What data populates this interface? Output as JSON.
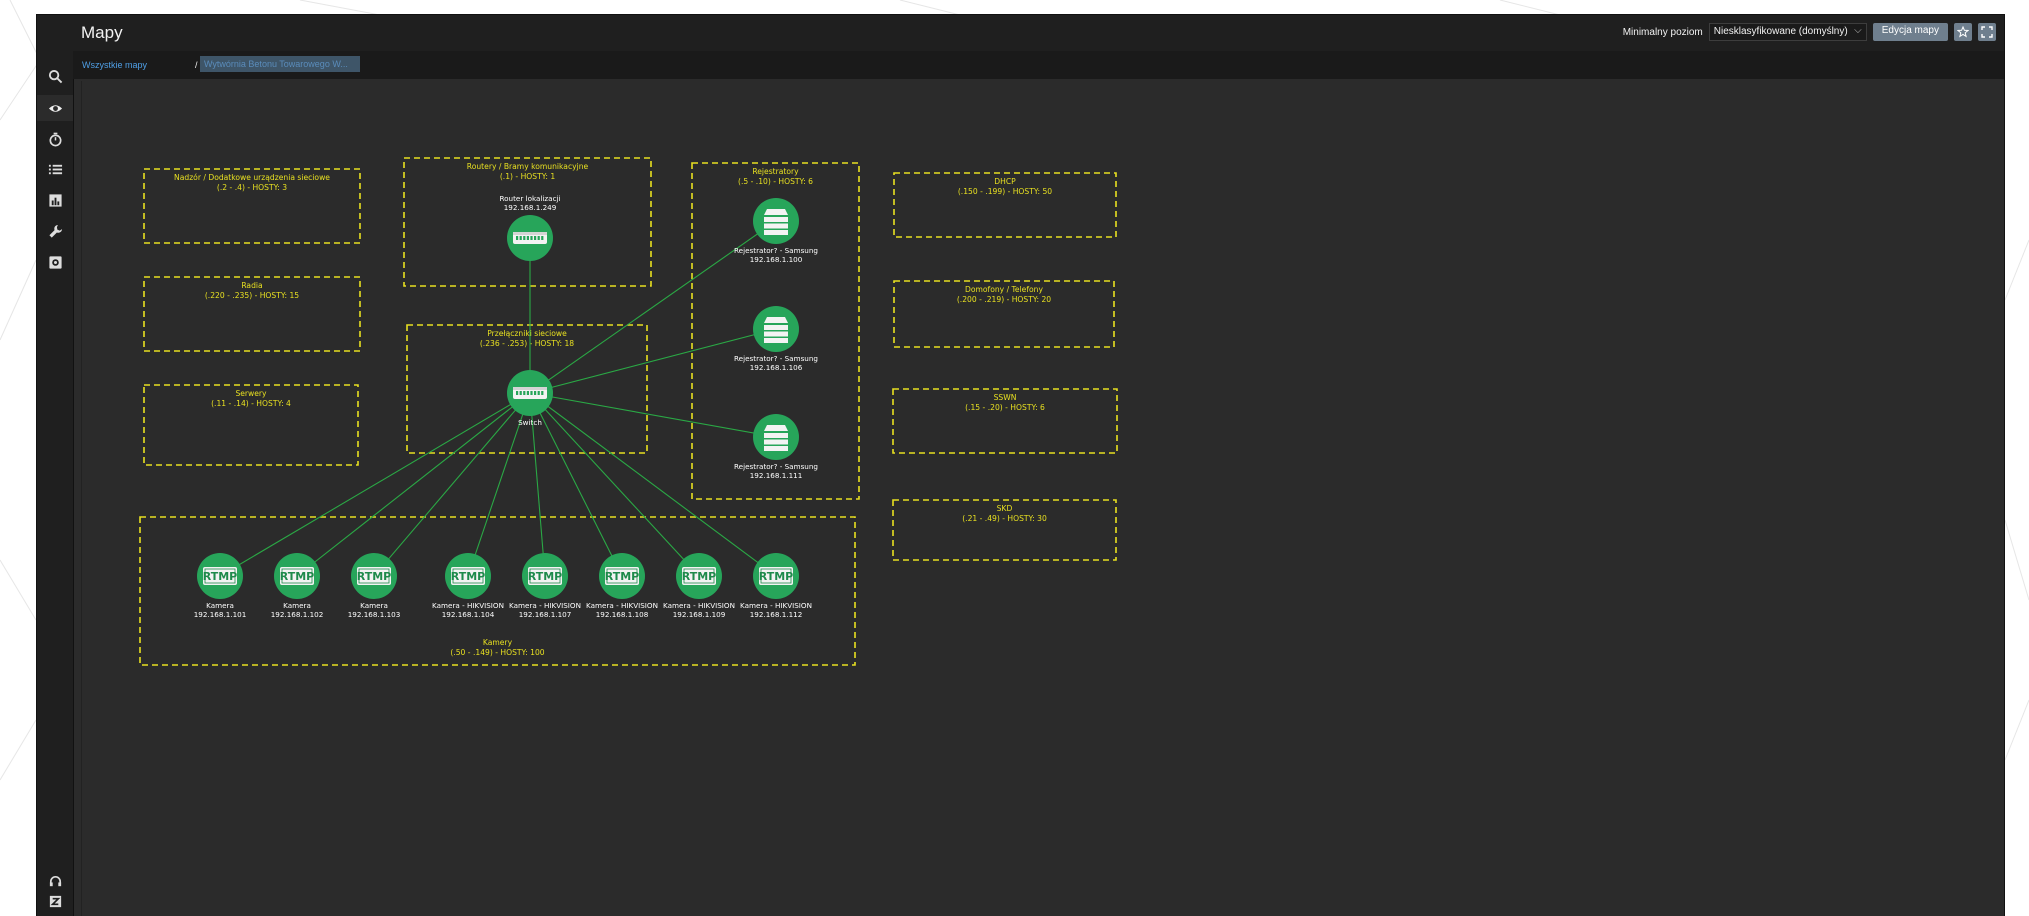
{
  "header": {
    "title": "Mapy",
    "min_level_label": "Minimalny poziom",
    "min_level_value": "Niesklasyfikowane (domyślny)",
    "edit_button": "Edycja mapy"
  },
  "breadcrumbs": [
    "Wszystkie mapy",
    "Wytwórnia Betonu Towarowego W..."
  ],
  "sidebar": {
    "top_icons": [
      "search-icon",
      "eye-icon",
      "stopwatch-icon",
      "list-icon",
      "chart-icon",
      "wrench-icon",
      "gear-icon"
    ],
    "bottom_icons": [
      "headset-icon",
      "zabbix-logo-icon"
    ]
  },
  "colors": {
    "group_border": "#e8e021",
    "group_label": "#e8e021",
    "node": "#27a55a",
    "link": "#2aa845",
    "link_text": "#4f9fe6"
  },
  "map": {
    "groups": [
      {
        "id": "nadzor",
        "label": [
          "Nadzór / Dodatkowe urządzenia sieciowe",
          "(.2 - .4) - HOSTY: 3"
        ]
      },
      {
        "id": "radia",
        "label": [
          "Radia",
          "(.220 - .235) - HOSTY: 15"
        ]
      },
      {
        "id": "serwery",
        "label": [
          "Serwery",
          "(.11 - .14) - HOSTY: 4"
        ]
      },
      {
        "id": "routery",
        "label": [
          "Routery / Bramy komunikacyjne",
          "(.1) - HOSTY: 1"
        ]
      },
      {
        "id": "przelaczniki",
        "label": [
          "Przełączniki sieciowe",
          "(.236 - .253) - HOSTY: 18"
        ]
      },
      {
        "id": "rejestratory",
        "label": [
          "Rejestratory",
          "(.5 - .10) - HOSTY: 6"
        ]
      },
      {
        "id": "dhcp",
        "label": [
          "DHCP",
          "(.150 - .199) - HOSTY: 50"
        ]
      },
      {
        "id": "domofony",
        "label": [
          "Domofony / Telefony",
          "(.200 - .219) - HOSTY: 20"
        ]
      },
      {
        "id": "sswn",
        "label": [
          "SSWN",
          "(.15 - .20) - HOSTY: 6"
        ]
      },
      {
        "id": "skd",
        "label": [
          "SKD",
          "(.21 - .49) - HOSTY: 30"
        ]
      },
      {
        "id": "kamery",
        "label": [
          "Kamery",
          "(.50 - .149) - HOSTY: 100"
        ]
      }
    ],
    "nodes": [
      {
        "id": "router",
        "type": "switch",
        "label": [
          "Router lokalizacji",
          "192.168.1.249"
        ]
      },
      {
        "id": "switch",
        "type": "switch",
        "label": [
          "Switch"
        ]
      },
      {
        "id": "rej1",
        "type": "server",
        "label": [
          "Rejestrator? - Samsung",
          "192.168.1.100"
        ]
      },
      {
        "id": "rej2",
        "type": "server",
        "label": [
          "Rejestrator? - Samsung",
          "192.168.1.106"
        ]
      },
      {
        "id": "rej3",
        "type": "server",
        "label": [
          "Rejestrator? - Samsung",
          "192.168.1.111"
        ]
      },
      {
        "id": "cam101",
        "type": "rtmp",
        "label": [
          "Kamera",
          "192.168.1.101"
        ]
      },
      {
        "id": "cam102",
        "type": "rtmp",
        "label": [
          "Kamera",
          "192.168.1.102"
        ]
      },
      {
        "id": "cam103",
        "type": "rtmp",
        "label": [
          "Kamera",
          "192.168.1.103"
        ]
      },
      {
        "id": "cam104",
        "type": "rtmp",
        "label": [
          "Kamera - HIKVISION",
          "192.168.1.104"
        ]
      },
      {
        "id": "cam107",
        "type": "rtmp",
        "label": [
          "Kamera - HIKVISION",
          "192.168.1.107"
        ]
      },
      {
        "id": "cam108",
        "type": "rtmp",
        "label": [
          "Kamera - HIKVISION",
          "192.168.1.108"
        ]
      },
      {
        "id": "cam109",
        "type": "rtmp",
        "label": [
          "Kamera - HIKVISION",
          "192.168.1.109"
        ]
      },
      {
        "id": "cam112",
        "type": "rtmp",
        "label": [
          "Kamera - HIKVISION",
          "192.168.1.112"
        ]
      }
    ],
    "links": [
      [
        "router",
        "switch"
      ],
      [
        "switch",
        "rej1"
      ],
      [
        "switch",
        "rej2"
      ],
      [
        "switch",
        "rej3"
      ],
      [
        "switch",
        "cam101"
      ],
      [
        "switch",
        "cam102"
      ],
      [
        "switch",
        "cam103"
      ],
      [
        "switch",
        "cam104"
      ],
      [
        "switch",
        "cam107"
      ],
      [
        "switch",
        "cam108"
      ],
      [
        "switch",
        "cam109"
      ],
      [
        "switch",
        "cam112"
      ]
    ],
    "rtmp_icon_text": "RTMP"
  }
}
